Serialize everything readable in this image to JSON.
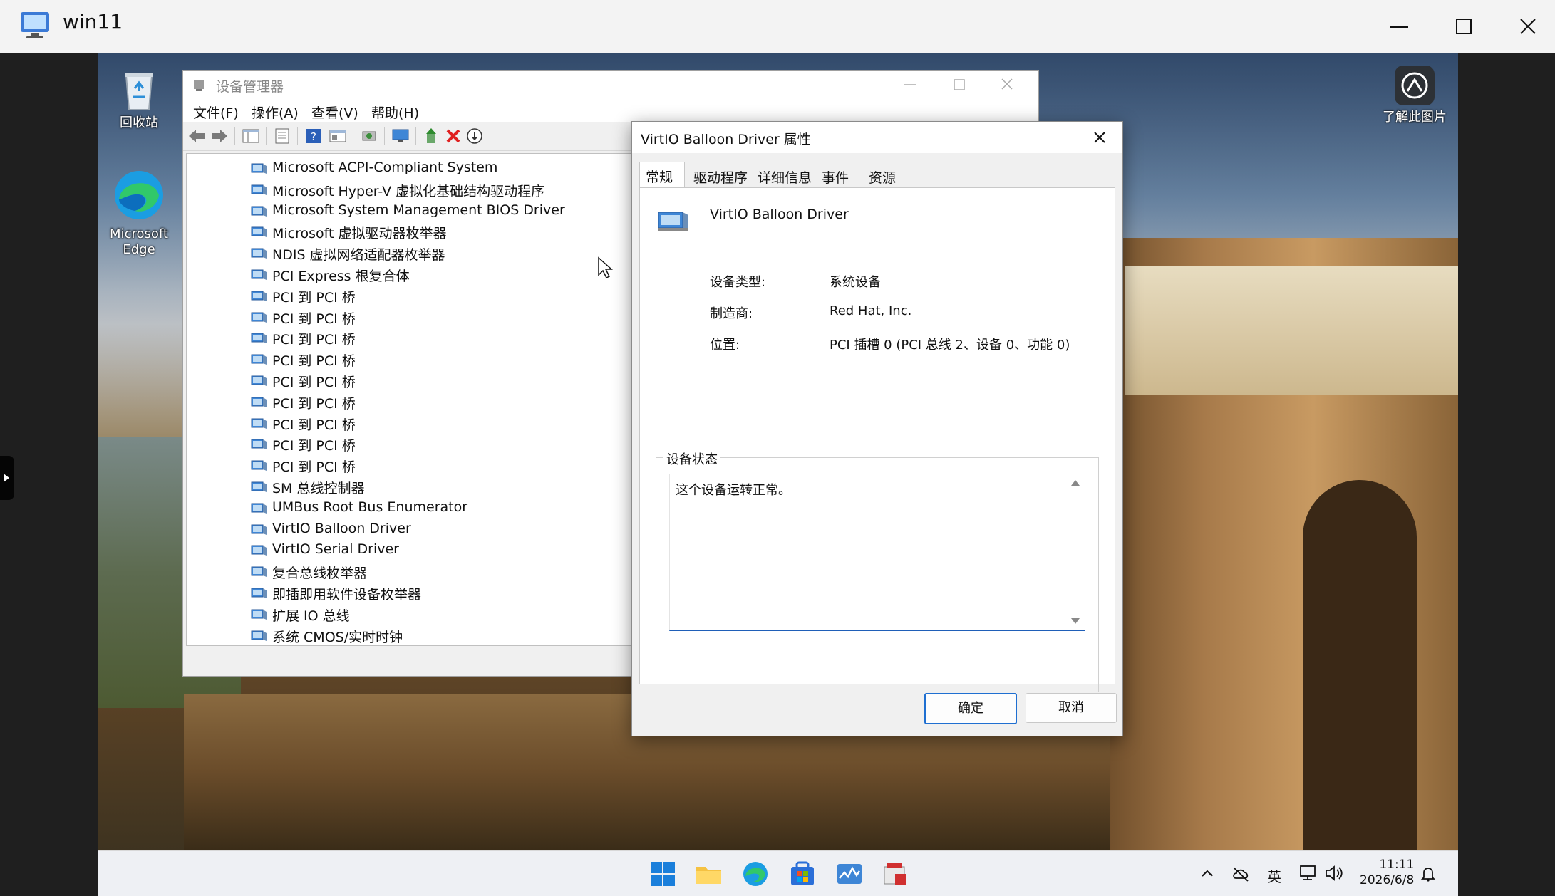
{
  "host": {
    "title": "win11",
    "controls": [
      "minimize",
      "maximize",
      "close"
    ]
  },
  "desktop": {
    "icons": [
      {
        "label": "回收站",
        "icon": "recycle-bin-icon"
      },
      {
        "label": "Microsoft Edge",
        "icon": "edge-icon"
      },
      {
        "label": "了解此图片",
        "icon": "learn-picture-icon"
      }
    ]
  },
  "device_manager": {
    "title": "设备管理器",
    "menu": [
      "文件(F)",
      "操作(A)",
      "查看(V)",
      "帮助(H)"
    ],
    "toolbar": [
      "back-icon",
      "forward-icon",
      "show-hide-tree-icon",
      "properties-icon",
      "help-icon",
      "view-icon",
      "scan-hardware-icon",
      "monitor-icon",
      "update-driver-icon",
      "uninstall-icon",
      "download-icon"
    ],
    "tree_items": [
      "Microsoft ACPI-Compliant System",
      "Microsoft Hyper-V 虚拟化基础结构驱动程序",
      "Microsoft System Management BIOS Driver",
      "Microsoft 虚拟驱动器枚举器",
      "NDIS 虚拟网络适配器枚举器",
      "PCI Express 根复合体",
      "PCI 到 PCI 桥",
      "PCI 到 PCI 桥",
      "PCI 到 PCI 桥",
      "PCI 到 PCI 桥",
      "PCI 到 PCI 桥",
      "PCI 到 PCI 桥",
      "PCI 到 PCI 桥",
      "PCI 到 PCI 桥",
      "PCI 到 PCI 桥",
      "SM 总线控制器",
      "UMBus Root Bus Enumerator",
      "VirtIO Balloon Driver",
      "VirtIO Serial Driver",
      "复合总线枚举器",
      "即插即用软件设备枚举器",
      "扩展 IO 总线",
      "系统 CMOS/实时时钟"
    ]
  },
  "properties": {
    "title": "VirtIO Balloon Driver 属性",
    "tabs": [
      "常规",
      "驱动程序",
      "详细信息",
      "事件",
      "资源"
    ],
    "active_tab": "常规",
    "device_name": "VirtIO Balloon Driver",
    "fields": [
      {
        "label": "设备类型:",
        "value": "系统设备"
      },
      {
        "label": "制造商:",
        "value": "Red Hat, Inc."
      },
      {
        "label": "位置:",
        "value": "PCI 插槽 0 (PCI 总线 2、设备 0、功能 0)"
      }
    ],
    "status_group_title": "设备状态",
    "status_text": "这个设备运转正常。",
    "ok_label": "确定",
    "cancel_label": "取消"
  },
  "taskbar": {
    "apps": [
      "start-icon",
      "file-explorer-icon",
      "edge-icon",
      "store-icon",
      "task-manager-icon",
      "device-tool-icon"
    ],
    "tray": {
      "ime": "英",
      "time": "11:11",
      "date": "2026/6/8"
    }
  },
  "colors": {
    "accent": "#1f6fd1",
    "close_red": "#e81123"
  }
}
